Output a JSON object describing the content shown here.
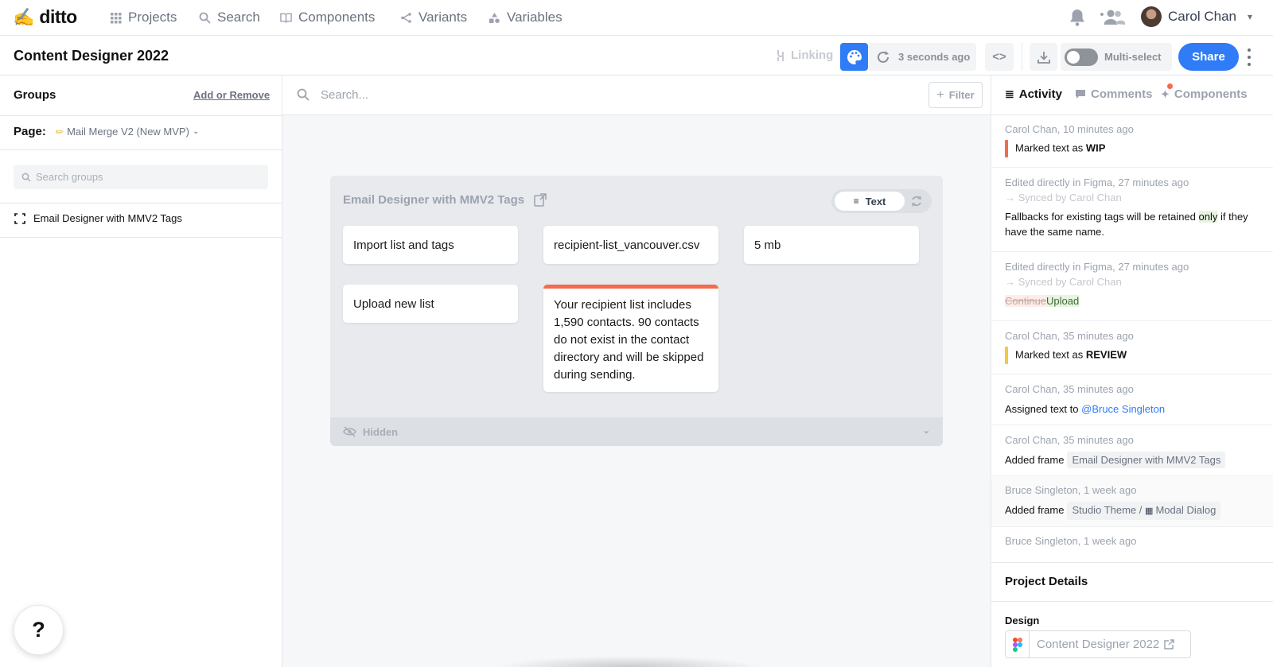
{
  "app": {
    "name": "ditto"
  },
  "nav": {
    "items": [
      "Projects",
      "Search",
      "Components",
      "Variants",
      "Variables"
    ],
    "user": "Carol Chan"
  },
  "header": {
    "title": "Content Designer 2022",
    "linking": "Linking",
    "synced": "3 seconds ago",
    "multi_select": "Multi-select",
    "share": "Share"
  },
  "left": {
    "groups_title": "Groups",
    "add_remove": "Add or Remove",
    "page_label": "Page:",
    "page_value": "Mail Merge V2 (New MVP)",
    "search_placeholder": "Search groups",
    "group_items": [
      "Email Designer with MMV2 Tags"
    ],
    "help": "?"
  },
  "center": {
    "search_placeholder": "Search...",
    "filter": "Filter",
    "frame": {
      "title": "Email Designer with MMV2 Tags",
      "toggle_label": "Text",
      "cards": [
        "Import list and tags",
        "recipient-list_vancouver.csv",
        "5 mb",
        "Upload new list",
        "Your recipient list includes 1,590 contacts. 90 contacts do not exist in the contact directory and will be skipped during sending."
      ],
      "hidden_label": "Hidden"
    }
  },
  "right": {
    "tabs": [
      "Activity",
      "Comments",
      "Components"
    ],
    "activity": [
      {
        "meta": "Carol Chan, 10 minutes ago",
        "pre": "Marked text as ",
        "strong": "WIP",
        "color": "#f46a4e"
      },
      {
        "meta": "Edited directly in Figma, 27 minutes ago",
        "synced": "→ Synced by Carol Chan",
        "text_a": "Fallbacks for existing tags will be retained ",
        "text_hl": "only",
        "text_b": " if they have the same name."
      },
      {
        "meta": "Edited directly in Figma, 27 minutes ago",
        "synced": "→ Synced by Carol Chan",
        "deleted": "Continue",
        "inserted": "Upload"
      },
      {
        "meta": "Carol Chan, 35 minutes ago",
        "pre": "Marked text as ",
        "strong": "REVIEW",
        "color": "#f5c842"
      },
      {
        "meta": "Carol Chan, 35 minutes ago",
        "pre": "Assigned text to ",
        "mention": "@Bruce Singleton"
      },
      {
        "meta": "Carol Chan, 35 minutes ago",
        "pre": "Added frame",
        "tag": "Email Designer with MMV2 Tags"
      },
      {
        "meta": "Bruce Singleton, 1 week ago",
        "pre": "Added frame",
        "tag_a": "Studio Theme / ",
        "tag_b": "Modal Dialog"
      },
      {
        "meta": "Bruce Singleton, 1 week ago"
      }
    ],
    "project_details": {
      "title": "Project Details",
      "design_label": "Design",
      "design_name": "Content Designer 2022"
    }
  },
  "colors": {
    "accent": "#2f7cf6",
    "warn": "#f46a4e",
    "review": "#f5c842"
  }
}
